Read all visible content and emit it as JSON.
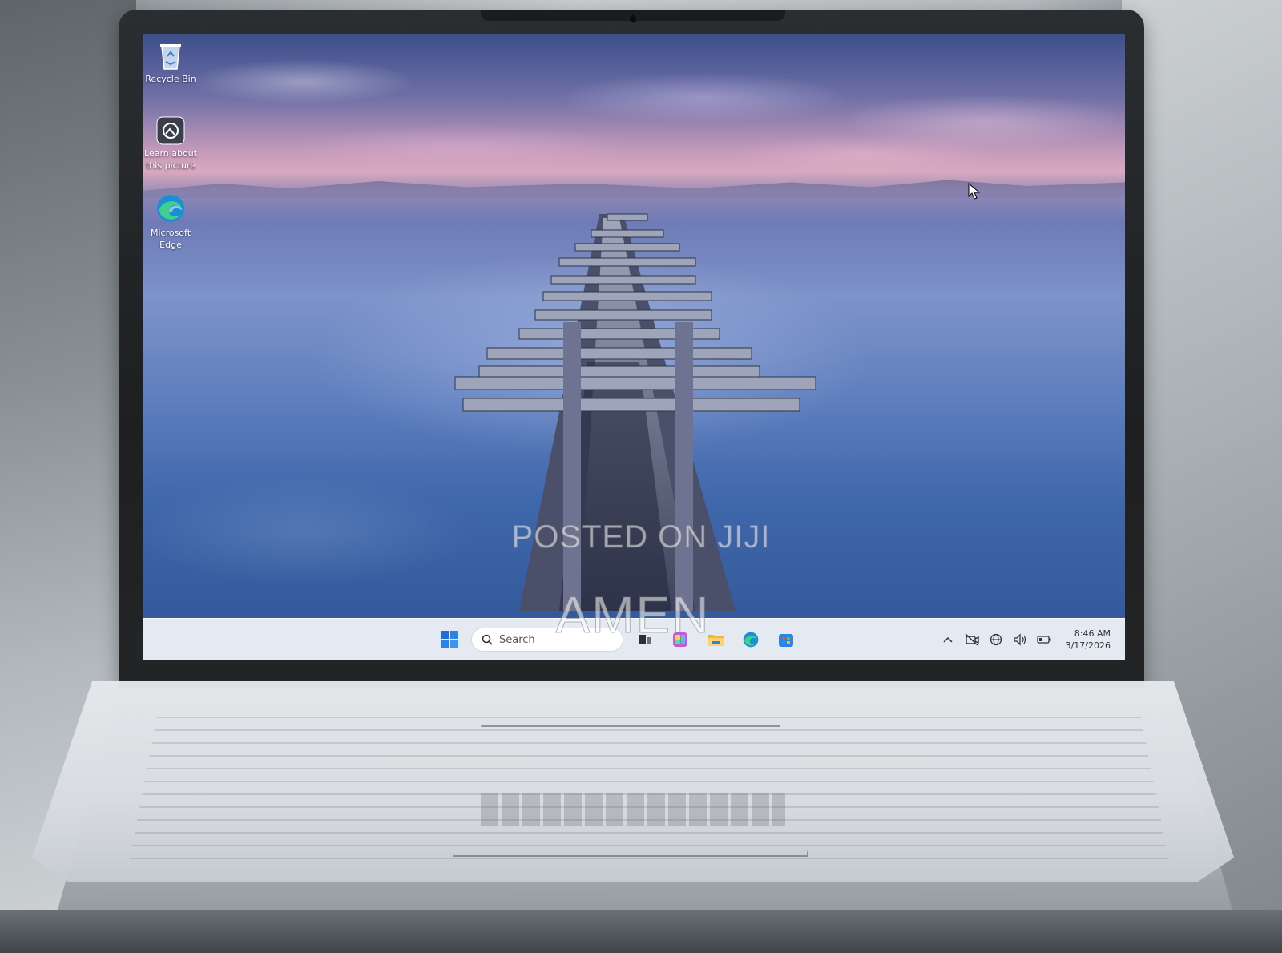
{
  "desktop": {
    "icons": [
      {
        "label": "Recycle Bin",
        "icon": "recycle-bin-icon"
      },
      {
        "label": "Learn about this picture",
        "icon": "learn-picture-icon"
      },
      {
        "label": "Microsoft Edge",
        "icon": "edge-icon"
      }
    ]
  },
  "taskbar": {
    "start_icon": "windows-start-icon",
    "search_placeholder": "Search",
    "pinned": [
      "task-view-icon",
      "widgets-icon",
      "file-explorer-icon",
      "edge-icon",
      "store-icon"
    ],
    "tray": [
      "chevron-up-icon",
      "camera-off-icon",
      "network-icon",
      "volume-icon",
      "battery-icon"
    ],
    "time": "8:46 AM",
    "date": "3/17/2026"
  },
  "watermark": {
    "line1": "POSTED ON JIJI",
    "line2": "AMEN"
  },
  "colors": {
    "taskbar_bg": "#ecf0f6",
    "accent_blue": "#1f6fd6",
    "sky_pink": "#d9a9bf",
    "water_blue": "#3f67ab"
  }
}
